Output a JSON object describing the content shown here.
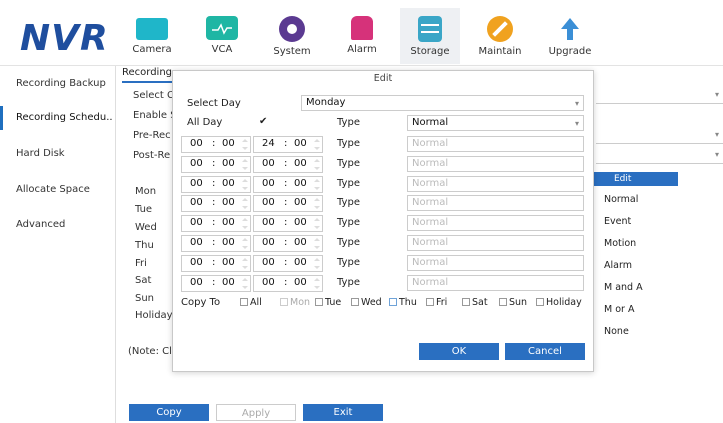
{
  "app": {
    "logo": "NVR"
  },
  "nav": [
    {
      "label": "Camera",
      "icon": "camera-icon",
      "color": "#1fb6c9"
    },
    {
      "label": "VCA",
      "icon": "vca-icon",
      "color": "#1fb6a4"
    },
    {
      "label": "System",
      "icon": "gear-icon",
      "color": "#5b3a91"
    },
    {
      "label": "Alarm",
      "icon": "alarm-icon",
      "color": "#d6327a"
    },
    {
      "label": "Storage",
      "icon": "storage-icon",
      "color": "#3aa6c7"
    },
    {
      "label": "Maintain",
      "icon": "wrench-icon",
      "color": "#f0a21f"
    },
    {
      "label": "Upgrade",
      "icon": "upgrade-icon",
      "color": "#3b8fd6"
    }
  ],
  "sidebar": [
    {
      "label": "Recording Backup"
    },
    {
      "label": "Recording Schedu.."
    },
    {
      "label": "Hard Disk"
    },
    {
      "label": "Allocate Space"
    },
    {
      "label": "Advanced"
    }
  ],
  "main": {
    "tab": "Recording",
    "select_c": "Select C",
    "enable_s": "Enable S",
    "pre_rec": "Pre-Rec",
    "post_re": "Post-Re",
    "days": [
      "Mon",
      "Tue",
      "Wed",
      "Thu",
      "Fri",
      "Sat",
      "Sun",
      "Holiday"
    ],
    "note": "(Note: Cli",
    "buttons": {
      "copy": "Copy",
      "apply": "Apply",
      "exit": "Exit"
    }
  },
  "type_dropdown": {
    "header": "Edit",
    "items": [
      "Normal",
      "Event",
      "Motion",
      "Alarm",
      "M and A",
      "M or A",
      "None"
    ]
  },
  "modal": {
    "title": "Edit",
    "select_day_label": "Select Day",
    "select_day_value": "Monday",
    "all_day_label": "All Day",
    "all_day_checked": "✔",
    "type_label": "Type",
    "first_type": "Normal",
    "rows": [
      {
        "sh": "00",
        "sm": "00",
        "eh": "24",
        "em": "00",
        "type": "Normal"
      },
      {
        "sh": "00",
        "sm": "00",
        "eh": "00",
        "em": "00",
        "type": "Normal"
      },
      {
        "sh": "00",
        "sm": "00",
        "eh": "00",
        "em": "00",
        "type": "Normal"
      },
      {
        "sh": "00",
        "sm": "00",
        "eh": "00",
        "em": "00",
        "type": "Normal"
      },
      {
        "sh": "00",
        "sm": "00",
        "eh": "00",
        "em": "00",
        "type": "Normal"
      },
      {
        "sh": "00",
        "sm": "00",
        "eh": "00",
        "em": "00",
        "type": "Normal"
      },
      {
        "sh": "00",
        "sm": "00",
        "eh": "00",
        "em": "00",
        "type": "Normal"
      },
      {
        "sh": "00",
        "sm": "00",
        "eh": "00",
        "em": "00",
        "type": "Normal"
      }
    ],
    "copy_to_label": "Copy To",
    "copy_to": [
      "All",
      "Mon",
      "Tue",
      "Wed",
      "Thu",
      "Fri",
      "Sat",
      "Sun",
      "Holiday"
    ],
    "ok": "OK",
    "cancel": "Cancel"
  },
  "colors": {
    "accent": "#2a6fc1",
    "logo": "#1f4e9e"
  }
}
